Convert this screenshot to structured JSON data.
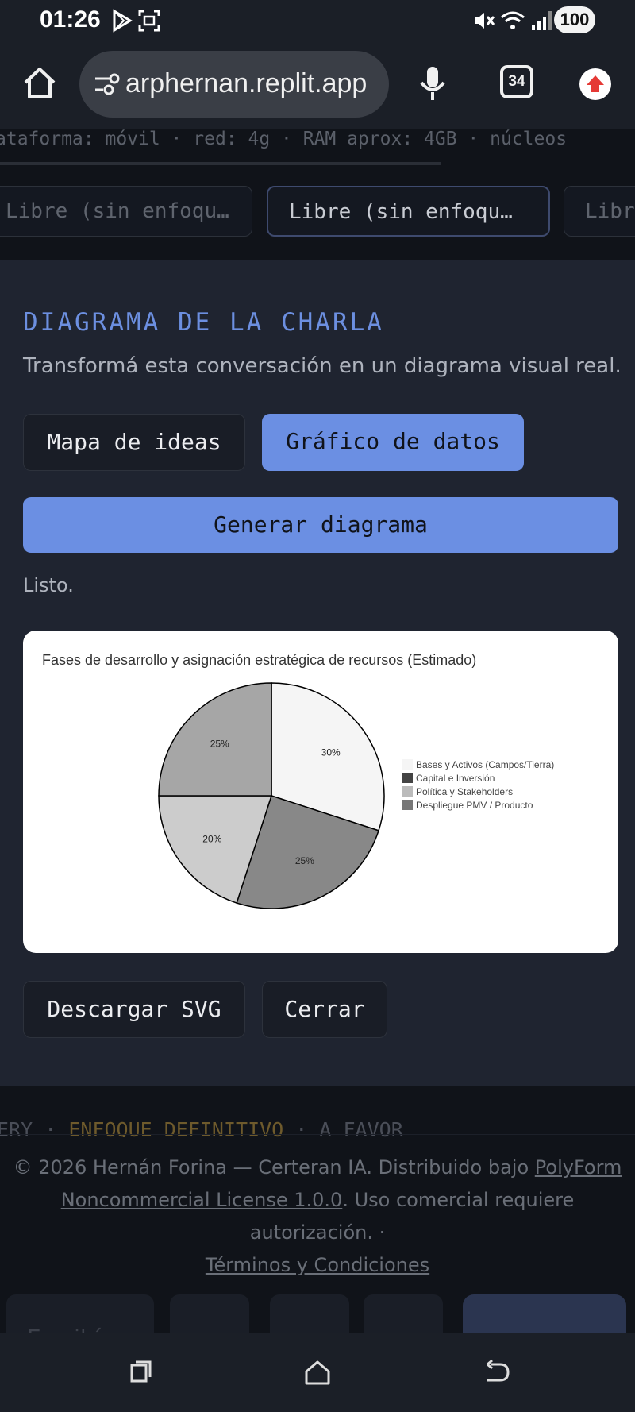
{
  "status_bar": {
    "time": "01:26",
    "battery": "100",
    "icons": [
      "play-store-icon",
      "screenshot-icon",
      "mute-icon",
      "wifi-icon",
      "signal-icon"
    ]
  },
  "browser": {
    "url": "arphernan.replit.app",
    "tab_count": "34"
  },
  "background_top": {
    "info_line": "ataforma: móvil · red: 4g · RAM aprox: 4GB · núcleos",
    "chips": [
      "Libre (sin enfoqu…",
      "Libre (sin enfoqu…",
      "Libr"
    ]
  },
  "diagram_panel": {
    "title": "DIAGRAMA DE LA CHARLA",
    "description": "Transformá esta conversación en un diagrama visual real.",
    "mode_ideas": "Mapa de ideas",
    "mode_data": "Gráfico de datos",
    "generate_label": "Generar diagrama",
    "status": "Listo.",
    "download_label": "Descargar SVG",
    "close_label": "Cerrar"
  },
  "chart_data": {
    "type": "pie",
    "title": "Fases de desarrollo y asignación estratégica de recursos (Estimado)",
    "categories": [
      "Bases y Activos (Campos/Tierra)",
      "Capital e Inversión",
      "Política y Stakeholders",
      "Despliegue PMV / Producto"
    ],
    "slices": [
      {
        "label": "30%",
        "value": 30,
        "color": "#f5f5f5"
      },
      {
        "label": "25%",
        "value": 25,
        "color": "#888888"
      },
      {
        "label": "20%",
        "value": 20,
        "color": "#cccccc"
      },
      {
        "label": "25%",
        "value": 25,
        "color": "#a6a6a6"
      }
    ],
    "legend": [
      {
        "name": "Bases y Activos (Campos/Tierra)",
        "color": "#f5f5f5"
      },
      {
        "name": "Capital e Inversión",
        "color": "#444444"
      },
      {
        "name": "Política y Stakeholders",
        "color": "#bbbbbb"
      },
      {
        "name": "Despliegue PMV / Producto",
        "color": "#777777"
      }
    ],
    "legend_position": "right"
  },
  "background_bottom": {
    "ticker_a": "ERY · ",
    "ticker_b": "ENFOQUE DEFINITIVO",
    "ticker_c": " · A FAVOR",
    "footer_text": "© 2026 Hernán Forina — Certeran IA. Distribuido bajo",
    "license_link_1": "PolyForm",
    "license_link_2": "Noncommercial License 1.0.0",
    "footer_text_2": ". Uso comercial requiere autorización. ·",
    "terms_link": "Términos y Condiciones",
    "composer_placeholder": "Escribí"
  },
  "colors": {
    "accent": "#6b8fe3",
    "panel_bg": "#1f2430"
  }
}
